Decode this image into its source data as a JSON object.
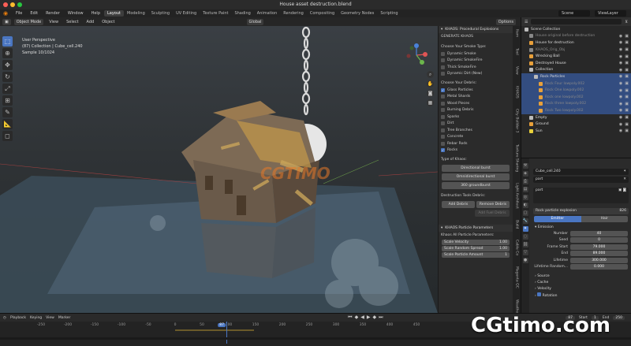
{
  "window": {
    "title": "House asset destruction.blend"
  },
  "menubar": {
    "items": [
      "File",
      "Edit",
      "Render",
      "Window",
      "Help"
    ],
    "workspaces": [
      "Layout",
      "Modeling",
      "Sculpting",
      "UV Editing",
      "Texture Paint",
      "Shading",
      "Animation",
      "Rendering",
      "Compositing",
      "Geometry Nodes",
      "Scripting"
    ],
    "active_workspace": "Layout",
    "scene": "Scene",
    "view_layer": "ViewLayer"
  },
  "toolheader": {
    "mode": "Object Mode",
    "menus": [
      "View",
      "Select",
      "Add",
      "Object"
    ],
    "orientation": "Global",
    "options": "Options"
  },
  "viewport": {
    "info_line1": "User Perspective",
    "info_line2": "(87) Collection | Cube_cell.240",
    "info_line3": "Sample 10/1024",
    "watermark": "CGTIMO"
  },
  "npanel": {
    "header": "KHAOS: Procedural Explosions",
    "generate": "GENERATE KHAOS",
    "smoke_label": "Choose Your Smoke Type:",
    "smoke_types": [
      {
        "label": "Dynamic Smoke",
        "checked": false
      },
      {
        "label": "Dynamic SmokeFire",
        "checked": false
      },
      {
        "label": "Thick SmokeFire",
        "checked": false
      },
      {
        "label": "Dynamic Dirt (New)",
        "checked": false
      }
    ],
    "debris_label": "Choose Your Debris:",
    "debris_types": [
      {
        "label": "Glass Particles",
        "checked": true
      },
      {
        "label": "Metal Shards",
        "checked": false
      },
      {
        "label": "Wood Pieces",
        "checked": false
      },
      {
        "label": "Burning Debris",
        "checked": false
      },
      {
        "label": "Sparks",
        "checked": false
      },
      {
        "label": "Dirt",
        "checked": false
      },
      {
        "label": "Tree Branches",
        "checked": false
      },
      {
        "label": "Concrete",
        "checked": false
      },
      {
        "label": "Rebar Rods",
        "checked": false
      },
      {
        "label": "Rocks",
        "checked": true
      }
    ],
    "khaos_type_label": "Type of Khaos:",
    "khaos_types": [
      "Directional burst",
      "Omnidirectional burst",
      "360 groundburst"
    ],
    "tools_label": "Destruction Tools Debris:",
    "add_debris": "Add Debris",
    "remove_debris": "Remove Debris",
    "add_fuel": "Add Fuel Debris",
    "particle_header": "KHAOS Particle Parameters",
    "particle_all": "Khaos All Particle Parameters:",
    "params": [
      {
        "label": "Scale Velocity",
        "value": "1.00"
      },
      {
        "label": "Scale Random Spread",
        "value": "1.00"
      },
      {
        "label": "Scale Particle Amount",
        "value": "1"
      }
    ]
  },
  "ntabs": [
    "Item",
    "Tool",
    "View",
    "KHAOS",
    "City Builder 3",
    "Texture Sharing",
    "Light Architect",
    "Build",
    "Cable Co",
    "Magenta QC",
    "Weather FX"
  ],
  "outliner": {
    "rows": [
      {
        "label": "Scene Collection",
        "indent": 0,
        "sel": false,
        "dim": false,
        "color": "#bbbbbb"
      },
      {
        "label": "House original before destruction",
        "indent": 1,
        "sel": false,
        "dim": true,
        "color": "#888888"
      },
      {
        "label": "House for destruction",
        "indent": 1,
        "sel": false,
        "dim": false,
        "color": "#e8a03a"
      },
      {
        "label": "KHAOS_Orig_Obj",
        "indent": 1,
        "sel": false,
        "dim": true,
        "color": "#888888"
      },
      {
        "label": "Wrecking Ball",
        "indent": 1,
        "sel": false,
        "dim": false,
        "color": "#e8a03a"
      },
      {
        "label": "Destroyed House",
        "indent": 1,
        "sel": false,
        "dim": false,
        "color": "#e8a03a"
      },
      {
        "label": "Collection",
        "indent": 1,
        "sel": false,
        "dim": false,
        "color": "#bbbbbb"
      },
      {
        "label": "Rock Particles",
        "indent": 2,
        "sel": true,
        "dim": false,
        "color": "#bbbbbb"
      },
      {
        "label": "Rock Four lowpoly.002",
        "indent": 3,
        "sel": true,
        "dim": true,
        "color": "#e8a03a"
      },
      {
        "label": "Rock One lowpoly.002",
        "indent": 3,
        "sel": true,
        "dim": true,
        "color": "#e8a03a"
      },
      {
        "label": "Rock one lowpoly.002",
        "indent": 3,
        "sel": true,
        "dim": true,
        "color": "#e8a03a"
      },
      {
        "label": "Rock three lowpoly.002",
        "indent": 3,
        "sel": true,
        "dim": true,
        "color": "#e8a03a"
      },
      {
        "label": "Rock Two lowpoly.002",
        "indent": 3,
        "sel": true,
        "dim": true,
        "color": "#e8a03a"
      },
      {
        "label": "Empty",
        "indent": 1,
        "sel": false,
        "dim": false,
        "color": "#bbbbbb"
      },
      {
        "label": "Ground",
        "indent": 1,
        "sel": false,
        "dim": false,
        "color": "#e8a03a"
      },
      {
        "label": "Sun",
        "indent": 1,
        "sel": false,
        "dim": false,
        "color": "#e8d03a"
      }
    ]
  },
  "props": {
    "object": "Cube_cell.240",
    "search": "part",
    "system": "part",
    "settings": "Rock particle explosion",
    "settings_users": "826",
    "types": [
      "Emitter",
      "Hair"
    ],
    "active_type": "Emitter",
    "emission": "Emission",
    "fields": [
      {
        "label": "Number",
        "value": "40"
      },
      {
        "label": "Seed",
        "value": "0"
      },
      {
        "label": "Frame Start",
        "value": "79.000"
      },
      {
        "label": "End",
        "value": "89.000"
      },
      {
        "label": "Lifetime",
        "value": "300.000"
      },
      {
        "label": "Lifetime Random...",
        "value": "0.000"
      }
    ],
    "sub": [
      "Source",
      "Cache",
      "Velocity",
      "Rotation"
    ]
  },
  "timeline": {
    "menus": [
      "Playback",
      "Keying",
      "View",
      "Marker"
    ],
    "current_frame": "87",
    "start_label": "Start",
    "start": "1",
    "end_label": "End",
    "end": "250",
    "ticks": [
      "-250",
      "-200",
      "-150",
      "-100",
      "-50",
      "0",
      "50",
      "87",
      "100",
      "150",
      "200",
      "250",
      "300",
      "350",
      "400",
      "450"
    ]
  },
  "brand": {
    "watermark": "CGtimo.com"
  }
}
